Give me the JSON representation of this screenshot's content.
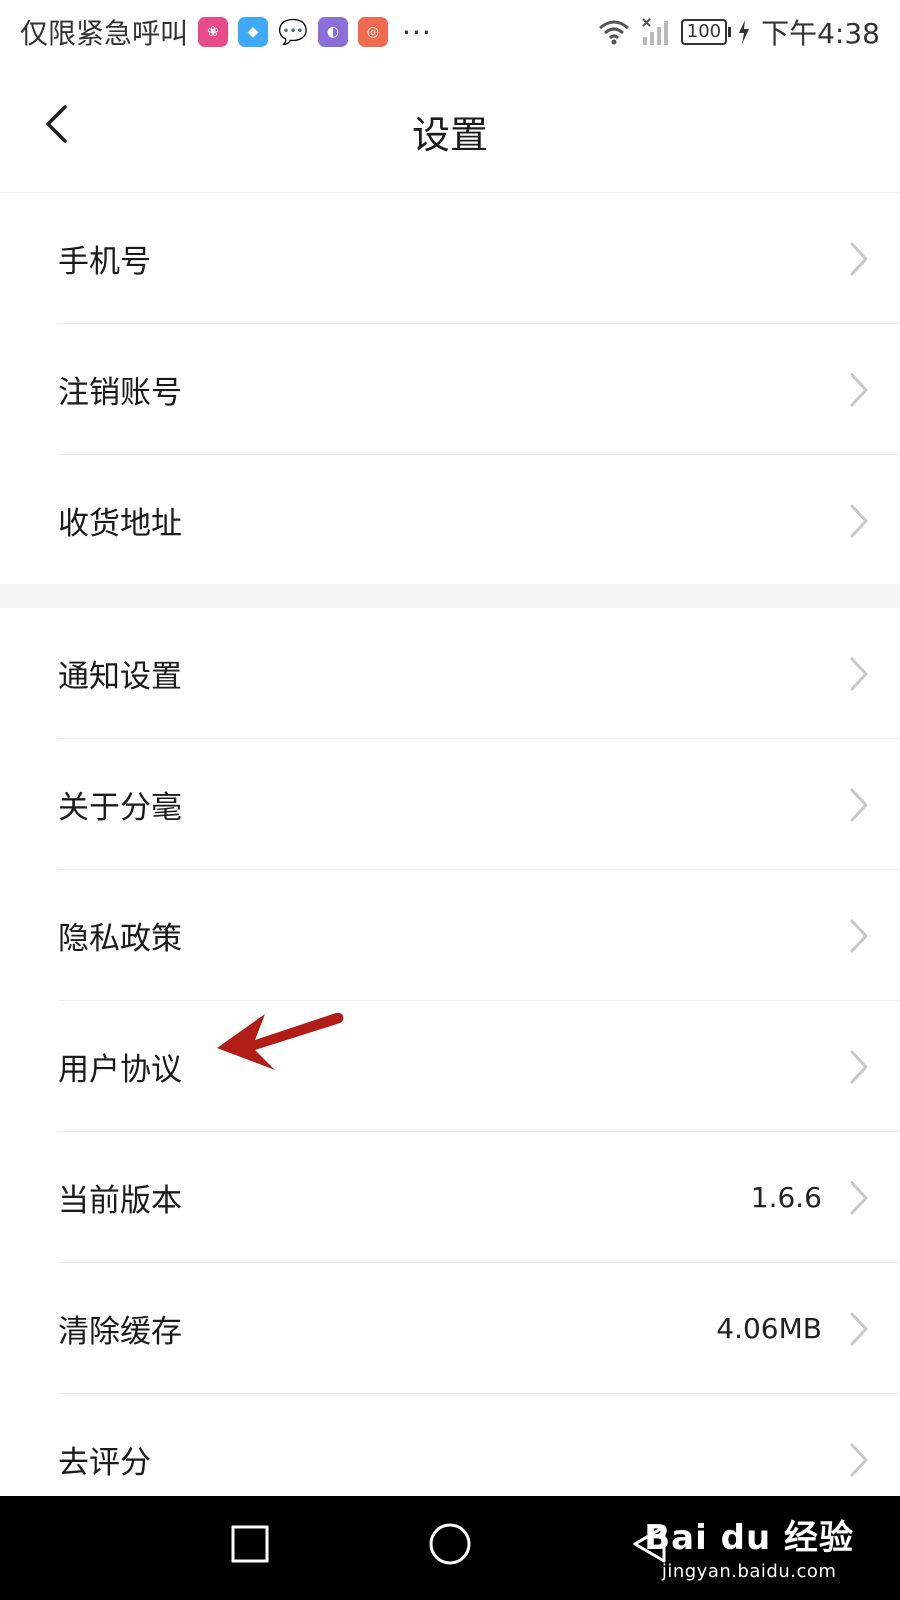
{
  "status_bar": {
    "carrier": "仅限紧急呼叫",
    "more": "···",
    "battery": "100",
    "time": "下午4:38",
    "icons": [
      "app-icon-pink",
      "app-icon-shield",
      "wechat-icon",
      "app-icon-purple",
      "app-icon-red",
      "wifi-icon",
      "signal-icon",
      "battery-icon",
      "charging-icon"
    ]
  },
  "header": {
    "title": "设置",
    "back_icon": "chevron-left-icon"
  },
  "groups": [
    {
      "items": [
        {
          "label": "手机号",
          "value": ""
        },
        {
          "label": "注销账号",
          "value": ""
        },
        {
          "label": "收货地址",
          "value": ""
        }
      ]
    },
    {
      "items": [
        {
          "label": "通知设置",
          "value": ""
        },
        {
          "label": "关于分毫",
          "value": ""
        },
        {
          "label": "隐私政策",
          "value": ""
        },
        {
          "label": "用户协议",
          "value": ""
        },
        {
          "label": "当前版本",
          "value": "1.6.6"
        },
        {
          "label": "清除缓存",
          "value": "4.06MB"
        },
        {
          "label": "去评分",
          "value": ""
        }
      ]
    }
  ],
  "nav_bar": {
    "buttons": [
      "recent-apps-icon",
      "home-icon",
      "back-triangle-icon"
    ]
  },
  "watermark": {
    "logo": "Bai du 经验",
    "url": "jingyan.baidu.com"
  },
  "colors": {
    "annotation_arrow": "#b01c16",
    "divider": "#eeeeee",
    "section_band": "#f4f4f4",
    "chevron": "#c8c8c8"
  }
}
